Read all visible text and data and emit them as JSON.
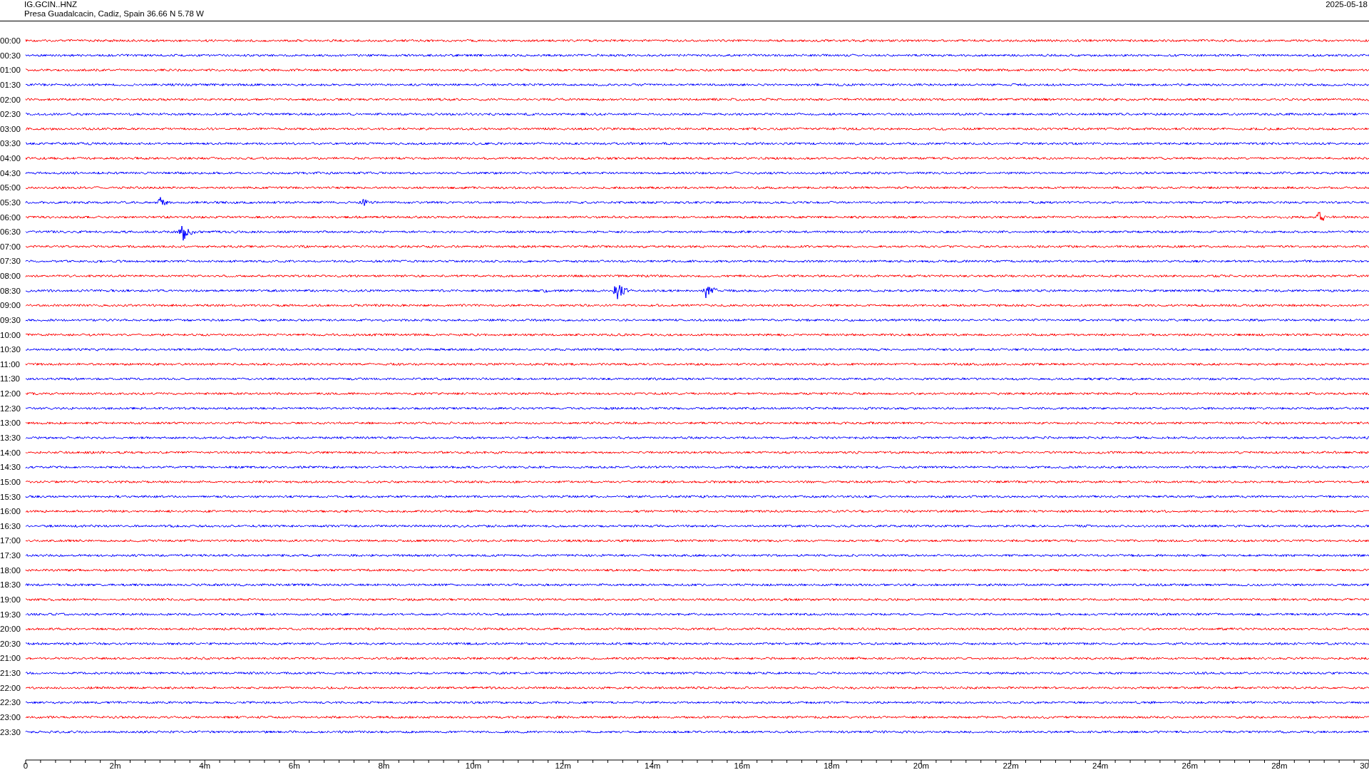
{
  "header": {
    "station": "IG.GCIN..HNZ",
    "location": "Presa Guadalcacin, Cadiz, Spain  36.66 N 5.78 W",
    "date": "2025-05-18"
  },
  "rows": [
    {
      "label": "00:00",
      "color": "#ff0000"
    },
    {
      "label": "00:30",
      "color": "#0000ff"
    },
    {
      "label": "01:00",
      "color": "#ff0000"
    },
    {
      "label": "01:30",
      "color": "#0000ff"
    },
    {
      "label": "02:00",
      "color": "#ff0000"
    },
    {
      "label": "02:30",
      "color": "#0000ff"
    },
    {
      "label": "03:00",
      "color": "#ff0000"
    },
    {
      "label": "03:30",
      "color": "#0000ff"
    },
    {
      "label": "04:00",
      "color": "#ff0000"
    },
    {
      "label": "04:30",
      "color": "#0000ff"
    },
    {
      "label": "05:00",
      "color": "#ff0000"
    },
    {
      "label": "05:30",
      "color": "#0000ff"
    },
    {
      "label": "06:00",
      "color": "#ff0000"
    },
    {
      "label": "06:30",
      "color": "#0000ff"
    },
    {
      "label": "07:00",
      "color": "#ff0000"
    },
    {
      "label": "07:30",
      "color": "#0000ff"
    },
    {
      "label": "08:00",
      "color": "#ff0000"
    },
    {
      "label": "08:30",
      "color": "#0000ff"
    },
    {
      "label": "09:00",
      "color": "#ff0000"
    },
    {
      "label": "09:30",
      "color": "#0000ff"
    },
    {
      "label": "10:00",
      "color": "#ff0000"
    },
    {
      "label": "10:30",
      "color": "#0000ff"
    },
    {
      "label": "11:00",
      "color": "#ff0000"
    },
    {
      "label": "11:30",
      "color": "#0000ff"
    },
    {
      "label": "12:00",
      "color": "#ff0000"
    },
    {
      "label": "12:30",
      "color": "#0000ff"
    },
    {
      "label": "13:00",
      "color": "#ff0000"
    },
    {
      "label": "13:30",
      "color": "#0000ff"
    },
    {
      "label": "14:00",
      "color": "#ff0000"
    },
    {
      "label": "14:30",
      "color": "#0000ff"
    },
    {
      "label": "15:00",
      "color": "#ff0000"
    },
    {
      "label": "15:30",
      "color": "#0000ff"
    },
    {
      "label": "16:00",
      "color": "#ff0000"
    },
    {
      "label": "16:30",
      "color": "#0000ff"
    },
    {
      "label": "17:00",
      "color": "#ff0000"
    },
    {
      "label": "17:30",
      "color": "#0000ff"
    },
    {
      "label": "18:00",
      "color": "#ff0000"
    },
    {
      "label": "18:30",
      "color": "#0000ff"
    },
    {
      "label": "19:00",
      "color": "#ff0000"
    },
    {
      "label": "19:30",
      "color": "#0000ff"
    },
    {
      "label": "20:00",
      "color": "#ff0000"
    },
    {
      "label": "20:30",
      "color": "#0000ff"
    },
    {
      "label": "21:00",
      "color": "#ff0000"
    },
    {
      "label": "21:30",
      "color": "#0000ff"
    },
    {
      "label": "22:00",
      "color": "#ff0000"
    },
    {
      "label": "22:30",
      "color": "#0000ff"
    },
    {
      "label": "23:00",
      "color": "#ff0000"
    },
    {
      "label": "23:30",
      "color": "#0000ff"
    }
  ],
  "x_axis_labels": [
    "0",
    "2m",
    "4m",
    "6m",
    "8m",
    "10m",
    "12m",
    "14m",
    "16m",
    "18m",
    "20m",
    "22m",
    "24m",
    "26m",
    "28m",
    "30"
  ]
}
